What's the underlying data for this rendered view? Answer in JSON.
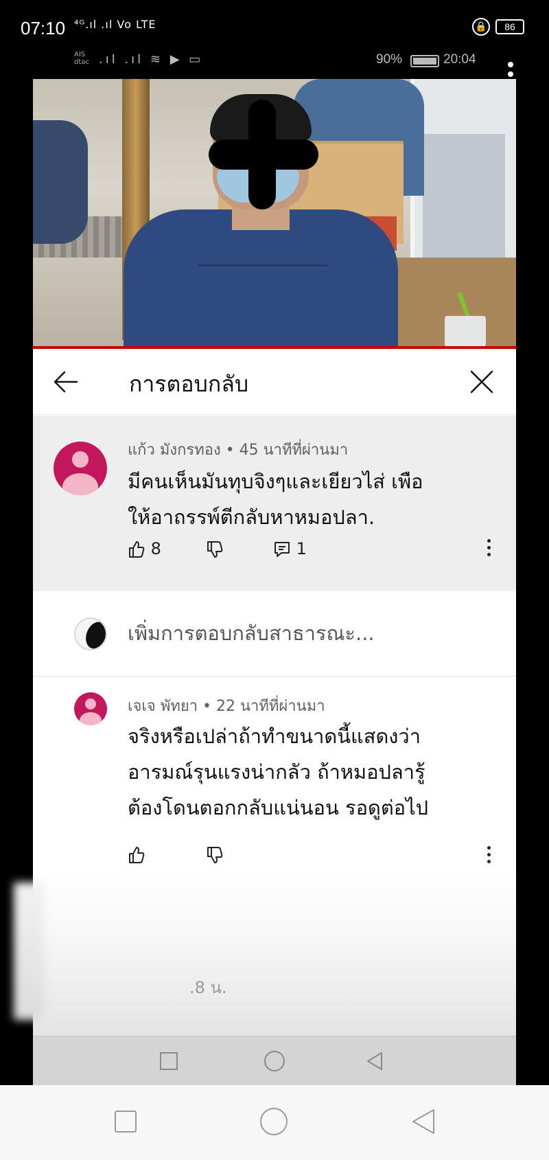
{
  "outer_status": {
    "time": "07:10",
    "signal": "⁴ᴳ.ıl .ıl",
    "volte": "Vo LTE",
    "battery": "86"
  },
  "inner_status": {
    "carriers": [
      "AIS",
      "dtac"
    ],
    "battery_percent": "90%",
    "clock": "20:04"
  },
  "panel": {
    "title": "การตอบกลับ",
    "comment": {
      "author_meta": "แก้ว มังกรทอง • 45 นาทีที่ผ่านมา",
      "text_lines": [
        "มีคนเห็นมันทุบจิงๆและเยียวไส่ เพือ",
        "ให้อาถรรพ์ตีกลับหาหมอปลา."
      ],
      "likes": "8",
      "replies": "1"
    },
    "reply_placeholder": "เพิ่มการตอบกลับสาธารณะ...",
    "reply": {
      "author_meta": "เจเจ พัทยา • 22 นาทีที่ผ่านมา",
      "text_lines": [
        "จริงหรือเปล่าถ้าทำขนาดนี้แสดงว่า",
        "อารมณ์รุนแรงน่ากลัว ถ้าหมอปลารู้",
        "ต้องโดนตอกกลับแน่นอน รอดูต่อไป"
      ]
    },
    "blurred_timestamp": ".8 น."
  },
  "colors": {
    "progress": "#cc0000",
    "avatar": "#c2185b",
    "avatar_face": "#f3b6c8"
  },
  "icons": [
    "back-arrow-icon",
    "close-icon",
    "thumb-up-icon",
    "thumb-down-icon",
    "reply-icon",
    "more-vert-icon",
    "nav-recent-icon",
    "nav-home-icon",
    "nav-back-icon"
  ]
}
